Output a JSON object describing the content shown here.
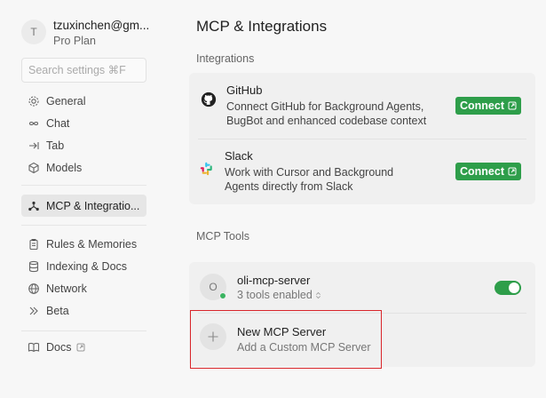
{
  "profile": {
    "initial": "T",
    "email": "tzuxinchen@gm...",
    "plan": "Pro Plan"
  },
  "search": {
    "placeholder": "Search settings ⌘F"
  },
  "nav": {
    "group1": [
      {
        "label": "General",
        "icon": "gear-icon"
      },
      {
        "label": "Chat",
        "icon": "infinity-icon"
      },
      {
        "label": "Tab",
        "icon": "arrow-right-tab-icon"
      },
      {
        "label": "Models",
        "icon": "cube-icon"
      }
    ],
    "active": {
      "label": "MCP & Integratio...",
      "icon": "network-nodes-icon"
    },
    "group2": [
      {
        "label": "Rules & Memories",
        "icon": "clipboard-icon"
      },
      {
        "label": "Indexing & Docs",
        "icon": "database-icon"
      },
      {
        "label": "Network",
        "icon": "globe-icon"
      },
      {
        "label": "Beta",
        "icon": "double-chevron-icon"
      }
    ],
    "docs": {
      "label": "Docs",
      "icon": "book-icon"
    }
  },
  "main": {
    "title": "MCP & Integrations",
    "integrations_label": "Integrations",
    "integrations": [
      {
        "name": "GitHub",
        "desc": "Connect GitHub for Background Agents, BugBot and enhanced codebase context",
        "button": "Connect",
        "icon": "github-icon"
      },
      {
        "name": "Slack",
        "desc": "Work with Cursor and Background Agents directly from Slack",
        "button": "Connect",
        "icon": "slack-icon"
      }
    ],
    "mcp_label": "MCP Tools",
    "server": {
      "initial": "O",
      "name": "oli-mcp-server",
      "tools": "3 tools enabled",
      "enabled": true
    },
    "new_server": {
      "title": "New MCP Server",
      "subtitle": "Add a Custom MCP Server"
    }
  },
  "colors": {
    "accent": "#2e9e4a",
    "highlight": "#d9262b"
  }
}
